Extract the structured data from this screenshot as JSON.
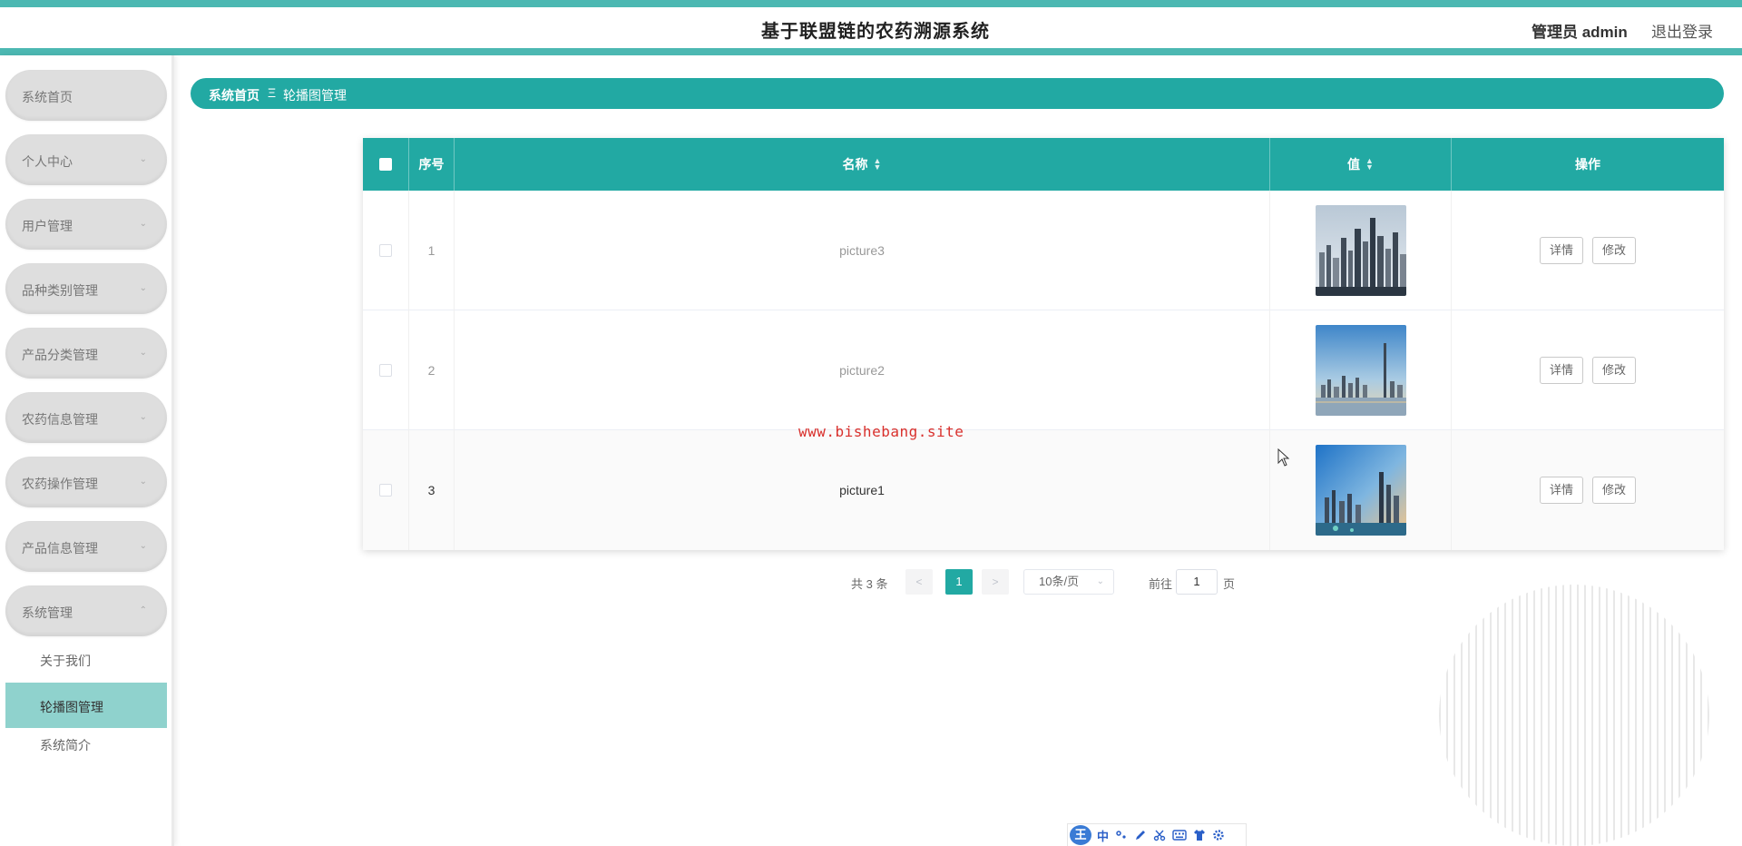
{
  "header": {
    "title": "基于联盟链的农药溯源系统",
    "user": "管理员 admin",
    "logout": "退出登录"
  },
  "sidebar": {
    "items": [
      {
        "label": "系统首页",
        "has_chevron": false
      },
      {
        "label": "个人中心",
        "has_chevron": true
      },
      {
        "label": "用户管理",
        "has_chevron": true
      },
      {
        "label": "品种类别管理",
        "has_chevron": true
      },
      {
        "label": "产品分类管理",
        "has_chevron": true
      },
      {
        "label": "农药信息管理",
        "has_chevron": true
      },
      {
        "label": "农药操作管理",
        "has_chevron": true
      },
      {
        "label": "产品信息管理",
        "has_chevron": true
      },
      {
        "label": "系统管理",
        "has_chevron": true,
        "expanded": true
      }
    ],
    "chevron_down": "⌄",
    "chevron_up": "⌃",
    "submenu": [
      {
        "label": "关于我们",
        "active": false
      },
      {
        "label": "轮播图管理",
        "active": true
      },
      {
        "label": "系统简介",
        "active": false
      }
    ]
  },
  "breadcrumb": {
    "home": "系统首页",
    "separator": "Ξ",
    "current": "轮播图管理"
  },
  "table": {
    "columns": {
      "index": "序号",
      "name": "名称",
      "value": "值",
      "actions": "操作"
    },
    "rows": [
      {
        "index": "1",
        "name": "picture3",
        "image": "city-skyline-1"
      },
      {
        "index": "2",
        "name": "picture2",
        "image": "city-skyline-2"
      },
      {
        "index": "3",
        "name": "picture1",
        "image": "city-skyline-3"
      }
    ],
    "detail_label": "详情",
    "edit_label": "修改"
  },
  "pagination": {
    "total": "共 3 条",
    "prev": "<",
    "current_page": "1",
    "next": ">",
    "page_size": "10条/页",
    "goto_prefix": "前往",
    "goto_value": "1",
    "goto_suffix": "页"
  },
  "watermark": "www.bishebang.site",
  "ime": {
    "logo": "王",
    "mode": "中"
  },
  "colors": {
    "accent": "#22a9a3",
    "header_stripe": "#4cb8b2",
    "active_submenu": "#8fd2cd"
  }
}
